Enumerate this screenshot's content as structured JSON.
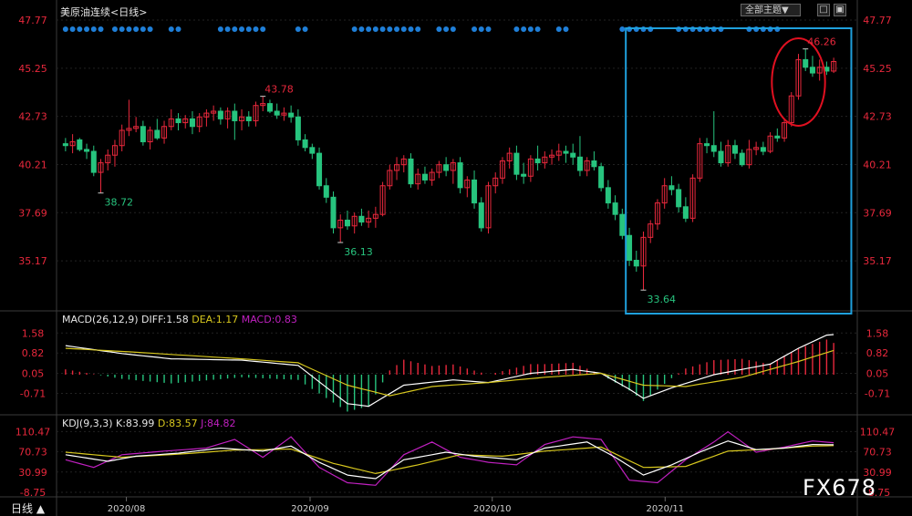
{
  "header": {
    "title": "美原油连续<日线>",
    "theme_select": "全部主题▼",
    "btn_restore": "□",
    "btn_close": "▣"
  },
  "timeframe": {
    "label": "日线 ▲"
  },
  "watermark": "FX678",
  "colors": {
    "up": "#e8283c",
    "down": "#27c47e",
    "diff": "#ffffff",
    "dea": "#d8c81e",
    "macd_text": "#c020c0",
    "j": "#c020c0",
    "dot": "#1f7fd8",
    "box": "#1fa0dc",
    "ellipse": "#e01020"
  },
  "chart_data": [
    {
      "type": "candlestick",
      "name": "美原油连续<日线>",
      "yticks": [
        47.77,
        45.25,
        42.73,
        40.21,
        37.69,
        35.17
      ],
      "ylim": [
        32.6,
        47.77
      ],
      "xticks": [
        "2020/08",
        "2020/09",
        "2020/10",
        "2020/11"
      ],
      "annotations": [
        "38.72",
        "43.78",
        "36.13",
        "33.64",
        "46.26"
      ],
      "candles": [
        [
          41.3,
          41.6,
          40.9,
          41.2
        ],
        [
          41.2,
          41.8,
          40.8,
          41.4
        ],
        [
          41.5,
          41.6,
          40.9,
          41.0
        ],
        [
          41.0,
          41.3,
          40.5,
          40.9
        ],
        [
          40.9,
          41.2,
          39.6,
          39.8
        ],
        [
          39.8,
          40.5,
          38.72,
          40.3
        ],
        [
          40.3,
          41.0,
          39.9,
          40.7
        ],
        [
          40.7,
          41.5,
          40.1,
          41.2
        ],
        [
          41.2,
          42.3,
          40.9,
          42.0
        ],
        [
          42.0,
          43.6,
          41.7,
          42.1
        ],
        [
          42.1,
          42.7,
          41.9,
          42.2
        ],
        [
          42.2,
          42.5,
          41.2,
          41.4
        ],
        [
          41.4,
          42.2,
          41.0,
          42.0
        ],
        [
          42.0,
          42.6,
          41.5,
          41.6
        ],
        [
          41.6,
          42.5,
          41.3,
          42.2
        ],
        [
          42.2,
          43.1,
          42.0,
          42.6
        ],
        [
          42.6,
          42.9,
          42.0,
          42.4
        ],
        [
          42.4,
          42.8,
          42.1,
          42.6
        ],
        [
          42.6,
          43.0,
          41.8,
          42.2
        ],
        [
          42.2,
          42.9,
          41.9,
          42.7
        ],
        [
          42.7,
          43.1,
          42.2,
          42.9
        ],
        [
          42.9,
          43.3,
          42.5,
          43.0
        ],
        [
          43.0,
          43.2,
          42.3,
          42.6
        ],
        [
          42.6,
          43.2,
          42.1,
          43.0
        ],
        [
          43.0,
          43.4,
          41.5,
          42.5
        ],
        [
          42.5,
          43.1,
          42.0,
          42.7
        ],
        [
          42.7,
          43.0,
          42.2,
          42.5
        ],
        [
          42.5,
          43.5,
          42.2,
          43.3
        ],
        [
          43.3,
          43.78,
          43.0,
          43.4
        ],
        [
          43.4,
          43.6,
          42.9,
          43.0
        ],
        [
          43.0,
          43.4,
          42.6,
          42.8
        ],
        [
          42.8,
          43.2,
          42.5,
          42.9
        ],
        [
          42.9,
          43.3,
          42.4,
          42.7
        ],
        [
          42.7,
          43.1,
          41.2,
          41.5
        ],
        [
          41.5,
          41.8,
          40.9,
          41.1
        ],
        [
          41.1,
          41.3,
          40.5,
          40.8
        ],
        [
          40.8,
          41.1,
          38.9,
          39.1
        ],
        [
          39.1,
          39.5,
          38.2,
          38.5
        ],
        [
          38.5,
          38.8,
          36.6,
          36.9
        ],
        [
          36.9,
          37.6,
          36.13,
          37.3
        ],
        [
          37.3,
          37.8,
          36.8,
          37.0
        ],
        [
          37.0,
          37.7,
          36.6,
          37.5
        ],
        [
          37.5,
          37.9,
          37.0,
          37.2
        ],
        [
          37.2,
          37.8,
          36.9,
          37.4
        ],
        [
          37.4,
          38.0,
          36.9,
          37.6
        ],
        [
          37.6,
          39.3,
          37.5,
          39.1
        ],
        [
          39.1,
          40.2,
          38.9,
          39.9
        ],
        [
          39.9,
          40.6,
          39.4,
          40.2
        ],
        [
          40.2,
          40.7,
          39.8,
          40.5
        ],
        [
          40.5,
          40.8,
          39.0,
          39.2
        ],
        [
          39.2,
          40.0,
          38.9,
          39.7
        ],
        [
          39.7,
          40.1,
          39.2,
          39.4
        ],
        [
          39.4,
          40.0,
          39.1,
          39.8
        ],
        [
          39.8,
          40.4,
          39.5,
          40.2
        ],
        [
          40.2,
          40.6,
          39.6,
          39.9
        ],
        [
          39.9,
          40.5,
          39.2,
          40.3
        ],
        [
          40.3,
          40.6,
          38.7,
          39.0
        ],
        [
          39.0,
          39.6,
          38.5,
          39.4
        ],
        [
          39.4,
          39.9,
          37.9,
          38.2
        ],
        [
          38.2,
          38.5,
          36.7,
          36.9
        ],
        [
          36.9,
          39.3,
          36.6,
          39.1
        ],
        [
          39.1,
          39.8,
          38.7,
          39.5
        ],
        [
          39.5,
          40.6,
          39.2,
          40.4
        ],
        [
          40.4,
          41.1,
          40.0,
          40.8
        ],
        [
          40.8,
          41.2,
          39.4,
          39.7
        ],
        [
          39.7,
          40.3,
          39.2,
          39.6
        ],
        [
          39.6,
          40.7,
          39.3,
          40.5
        ],
        [
          40.5,
          41.2,
          39.9,
          40.3
        ],
        [
          40.3,
          40.9,
          40.0,
          40.6
        ],
        [
          40.6,
          41.0,
          40.2,
          40.7
        ],
        [
          40.7,
          41.3,
          40.4,
          40.9
        ],
        [
          40.9,
          41.2,
          40.3,
          40.8
        ],
        [
          40.8,
          41.3,
          40.2,
          40.6
        ],
        [
          40.6,
          41.7,
          39.6,
          39.9
        ],
        [
          39.9,
          40.6,
          39.6,
          40.4
        ],
        [
          40.4,
          40.9,
          39.9,
          40.1
        ],
        [
          40.1,
          40.3,
          38.8,
          39.0
        ],
        [
          39.0,
          39.4,
          37.9,
          38.2
        ],
        [
          38.2,
          38.6,
          37.3,
          37.6
        ],
        [
          37.6,
          37.9,
          36.3,
          36.5
        ],
        [
          36.5,
          36.9,
          34.9,
          35.2
        ],
        [
          35.2,
          35.7,
          34.6,
          34.9
        ],
        [
          34.9,
          36.7,
          33.64,
          36.4
        ],
        [
          36.4,
          37.3,
          36.1,
          37.1
        ],
        [
          37.1,
          38.4,
          36.8,
          38.2
        ],
        [
          38.2,
          39.5,
          37.9,
          39.1
        ],
        [
          39.1,
          39.6,
          38.6,
          38.9
        ],
        [
          38.9,
          39.2,
          37.7,
          38.0
        ],
        [
          38.0,
          38.5,
          37.2,
          37.4
        ],
        [
          37.4,
          39.7,
          37.2,
          39.5
        ],
        [
          39.5,
          41.6,
          39.3,
          41.3
        ],
        [
          41.3,
          41.6,
          40.8,
          41.2
        ],
        [
          41.2,
          43.0,
          40.6,
          40.9
        ],
        [
          40.9,
          41.4,
          40.1,
          40.3
        ],
        [
          40.3,
          41.5,
          40.1,
          41.2
        ],
        [
          41.2,
          41.5,
          40.5,
          40.8
        ],
        [
          40.8,
          41.0,
          40.1,
          40.2
        ],
        [
          40.2,
          41.5,
          40.0,
          41.0
        ],
        [
          41.0,
          41.4,
          40.7,
          41.1
        ],
        [
          41.1,
          41.4,
          40.7,
          40.9
        ],
        [
          40.9,
          41.9,
          40.8,
          41.7
        ],
        [
          41.7,
          42.1,
          41.4,
          41.6
        ],
        [
          41.6,
          42.6,
          41.4,
          42.4
        ],
        [
          42.4,
          44.0,
          42.2,
          43.8
        ],
        [
          43.8,
          46.0,
          43.6,
          45.7
        ],
        [
          45.7,
          46.26,
          45.1,
          45.3
        ],
        [
          45.3,
          45.9,
          44.8,
          45.0
        ],
        [
          45.0,
          45.7,
          44.6,
          45.3
        ],
        [
          45.3,
          45.6,
          44.9,
          45.1
        ],
        [
          45.1,
          45.8,
          45.0,
          45.6
        ]
      ],
      "dot_groups": [
        [
          0,
          5
        ],
        [
          7,
          9
        ],
        [
          10,
          12
        ],
        [
          15,
          16
        ],
        [
          22,
          28
        ],
        [
          33,
          34
        ],
        [
          41,
          50
        ],
        [
          53,
          55
        ],
        [
          58,
          60
        ],
        [
          64,
          65
        ],
        [
          66,
          67
        ],
        [
          70,
          71
        ],
        [
          79,
          80
        ],
        [
          81,
          83
        ],
        [
          87,
          93
        ],
        [
          97,
          99
        ],
        [
          100,
          101
        ]
      ],
      "highlight_box": {
        "from": 80,
        "to": 112
      },
      "highlight_ellipse": {
        "from": 101,
        "to": 107
      }
    },
    {
      "type": "line",
      "name": "MACD",
      "header": {
        "label": "MACD(26,12,9)",
        "diff": "DIFF:1.58",
        "dea": "DEA:1.17",
        "macd": "MACD:0.83"
      },
      "yticks": [
        1.58,
        0.82,
        0.05,
        -0.71
      ],
      "ylim": [
        -1.35,
        1.9
      ],
      "diff_keypoints": [
        [
          0,
          1.1
        ],
        [
          8,
          0.8
        ],
        [
          15,
          0.6
        ],
        [
          25,
          0.55
        ],
        [
          33,
          0.35
        ],
        [
          40,
          -1.1
        ],
        [
          43,
          -1.2
        ],
        [
          48,
          -0.4
        ],
        [
          55,
          -0.2
        ],
        [
          60,
          -0.3
        ],
        [
          66,
          0.05
        ],
        [
          72,
          0.2
        ],
        [
          76,
          0.05
        ],
        [
          80,
          -0.55
        ],
        [
          82,
          -0.9
        ],
        [
          86,
          -0.5
        ],
        [
          92,
          0.0
        ],
        [
          100,
          0.4
        ],
        [
          104,
          1.0
        ],
        [
          108,
          1.5
        ],
        [
          112,
          1.58
        ]
      ],
      "dea_keypoints": [
        [
          0,
          1.0
        ],
        [
          10,
          0.85
        ],
        [
          25,
          0.6
        ],
        [
          33,
          0.45
        ],
        [
          40,
          -0.4
        ],
        [
          46,
          -0.8
        ],
        [
          52,
          -0.45
        ],
        [
          60,
          -0.3
        ],
        [
          68,
          -0.1
        ],
        [
          76,
          0.05
        ],
        [
          82,
          -0.4
        ],
        [
          88,
          -0.45
        ],
        [
          96,
          -0.1
        ],
        [
          104,
          0.5
        ],
        [
          112,
          1.17
        ]
      ]
    },
    {
      "type": "line",
      "name": "KDJ",
      "header": {
        "label": "KDJ(9,3,3)",
        "k": "K:83.99",
        "d": "D:83.57",
        "j": "J:84.82"
      },
      "yticks": [
        110.47,
        70.73,
        30.99,
        -8.75
      ],
      "ylim": [
        -8.75,
        120
      ],
      "k_keypoints": [
        [
          0,
          65
        ],
        [
          6,
          52
        ],
        [
          10,
          62
        ],
        [
          16,
          68
        ],
        [
          22,
          78
        ],
        [
          28,
          72
        ],
        [
          32,
          82
        ],
        [
          36,
          50
        ],
        [
          40,
          25
        ],
        [
          44,
          18
        ],
        [
          48,
          55
        ],
        [
          54,
          70
        ],
        [
          58,
          62
        ],
        [
          64,
          55
        ],
        [
          68,
          78
        ],
        [
          74,
          90
        ],
        [
          78,
          60
        ],
        [
          82,
          25
        ],
        [
          86,
          45
        ],
        [
          90,
          70
        ],
        [
          94,
          92
        ],
        [
          98,
          75
        ],
        [
          102,
          78
        ],
        [
          106,
          85
        ],
        [
          112,
          84
        ]
      ],
      "d_keypoints": [
        [
          0,
          70
        ],
        [
          8,
          60
        ],
        [
          16,
          66
        ],
        [
          24,
          74
        ],
        [
          32,
          76
        ],
        [
          38,
          48
        ],
        [
          44,
          28
        ],
        [
          50,
          45
        ],
        [
          56,
          65
        ],
        [
          62,
          62
        ],
        [
          68,
          72
        ],
        [
          76,
          80
        ],
        [
          82,
          40
        ],
        [
          88,
          42
        ],
        [
          94,
          72
        ],
        [
          100,
          76
        ],
        [
          106,
          82
        ],
        [
          112,
          83.6
        ]
      ],
      "j_keypoints": [
        [
          0,
          55
        ],
        [
          4,
          40
        ],
        [
          8,
          65
        ],
        [
          14,
          72
        ],
        [
          20,
          78
        ],
        [
          24,
          95
        ],
        [
          28,
          60
        ],
        [
          32,
          100
        ],
        [
          36,
          40
        ],
        [
          40,
          10
        ],
        [
          44,
          5
        ],
        [
          48,
          65
        ],
        [
          52,
          90
        ],
        [
          56,
          60
        ],
        [
          60,
          50
        ],
        [
          64,
          45
        ],
        [
          68,
          85
        ],
        [
          72,
          100
        ],
        [
          76,
          95
        ],
        [
          80,
          15
        ],
        [
          84,
          10
        ],
        [
          88,
          55
        ],
        [
          92,
          90
        ],
        [
          94,
          110
        ],
        [
          98,
          70
        ],
        [
          102,
          80
        ],
        [
          106,
          92
        ],
        [
          112,
          85
        ]
      ]
    }
  ]
}
